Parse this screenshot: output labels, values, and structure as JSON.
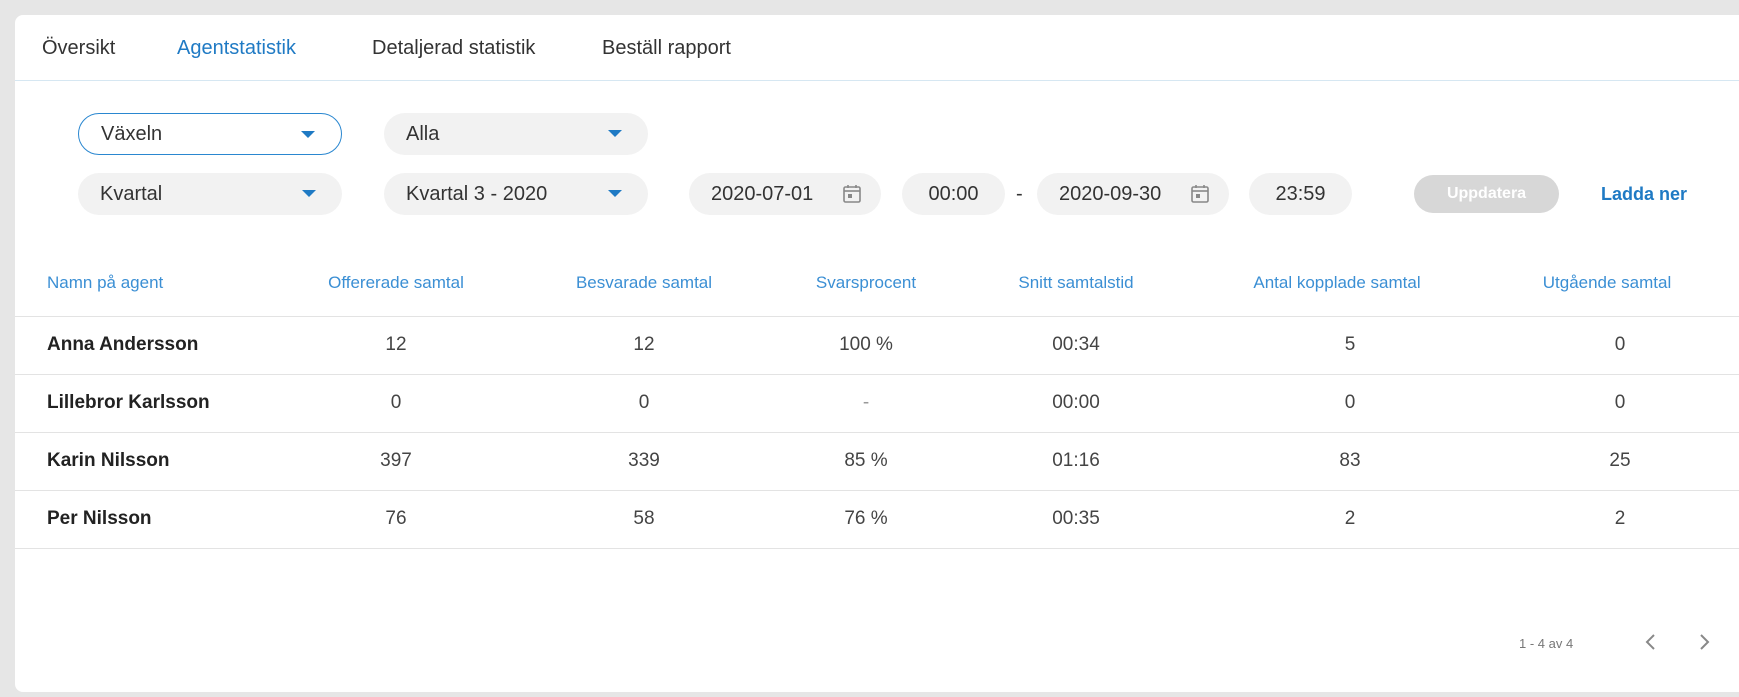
{
  "tabs": [
    {
      "label": "Översikt",
      "active": false
    },
    {
      "label": "Agentstatistik",
      "active": true
    },
    {
      "label": "Detaljerad statistik",
      "active": false
    },
    {
      "label": "Beställ rapport",
      "active": false
    }
  ],
  "filters": {
    "group_select": "Växeln",
    "agent_select": "Alla",
    "period_type_select": "Kvartal",
    "period_select": "Kvartal 3 - 2020",
    "start_date": "2020-07-01",
    "start_time": "00:00",
    "range_separator": "-",
    "end_date": "2020-09-30",
    "end_time": "23:59",
    "update_label": "Uppdatera",
    "download_label": "Ladda ner"
  },
  "table": {
    "columns": [
      "Namn på agent",
      "Offererade samtal",
      "Besvarade samtal",
      "Svarsprocent",
      "Snitt samtalstid",
      "Antal kopplade samtal",
      "Utgående samtal"
    ],
    "rows": [
      [
        "Anna Andersson",
        "12",
        "12",
        "100 %",
        "00:34",
        "5",
        "0"
      ],
      [
        "Lillebror Karlsson",
        "0",
        "0",
        "-",
        "00:00",
        "0",
        "0"
      ],
      [
        "Karin Nilsson",
        "397",
        "339",
        "85 %",
        "01:16",
        "83",
        "25"
      ],
      [
        "Per Nilsson",
        "76",
        "58",
        "76 %",
        "00:35",
        "2",
        "2"
      ]
    ]
  },
  "pagination": {
    "range_text": "1 - 4 av 4"
  },
  "colors": {
    "accent": "#1f7ac4",
    "header_text": "#3b8fd4",
    "pill_bg": "#f2f2f2",
    "disabled_button": "#d7d7d7"
  }
}
